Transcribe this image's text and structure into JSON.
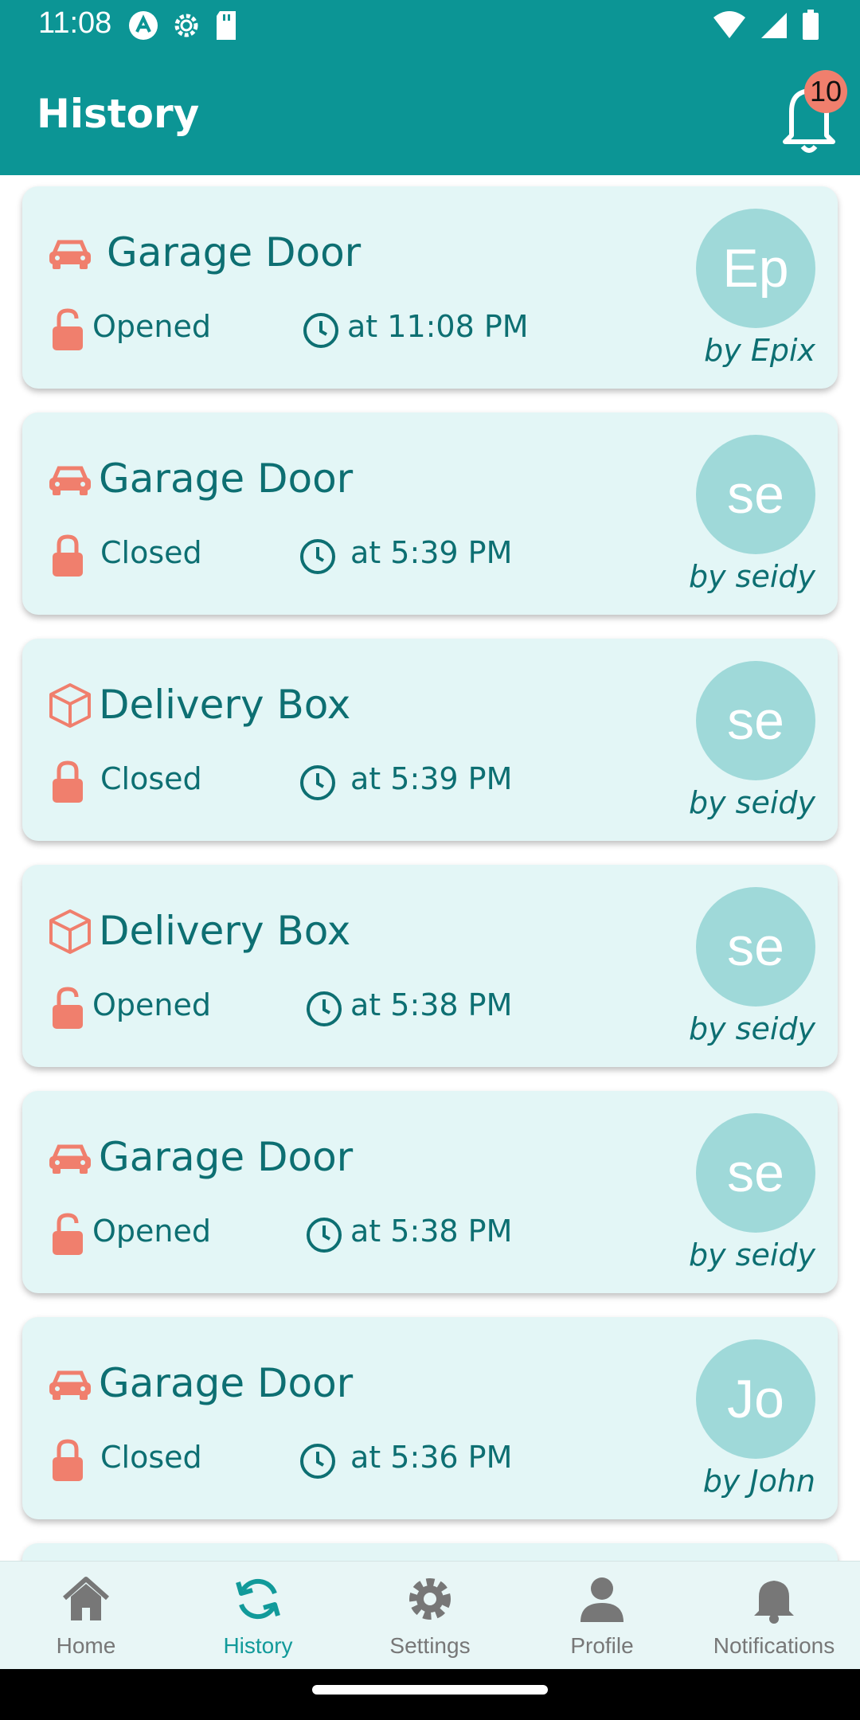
{
  "status_bar": {
    "time": "11:08",
    "left_icons": [
      "app-notification-icon",
      "settings-gear-icon",
      "sd-card-icon"
    ],
    "right_icons": [
      "wifi-icon",
      "cell-signal-icon",
      "battery-icon"
    ]
  },
  "app_bar": {
    "title": "History",
    "notification_count": "10",
    "bell_icon": "bell-icon"
  },
  "history": [
    {
      "device": "Garage Door",
      "device_icon": "car-icon",
      "state": "Opened",
      "lock_state": "unlocked",
      "time": "at 11:08 PM",
      "avatar_initials": "Ep",
      "by": "by Epix"
    },
    {
      "device": "Garage Door",
      "device_icon": "car-icon",
      "state": "Closed",
      "lock_state": "locked",
      "time": "at 5:39 PM",
      "avatar_initials": "se",
      "by": "by seidy"
    },
    {
      "device": "Delivery Box",
      "device_icon": "box-icon",
      "state": "Closed",
      "lock_state": "locked",
      "time": "at 5:39 PM",
      "avatar_initials": "se",
      "by": "by seidy"
    },
    {
      "device": "Delivery Box",
      "device_icon": "box-icon",
      "state": "Opened",
      "lock_state": "unlocked",
      "time": "at 5:38 PM",
      "avatar_initials": "se",
      "by": "by seidy"
    },
    {
      "device": "Garage Door",
      "device_icon": "car-icon",
      "state": "Opened",
      "lock_state": "unlocked",
      "time": "at 5:38 PM",
      "avatar_initials": "se",
      "by": "by seidy"
    },
    {
      "device": "Garage Door",
      "device_icon": "car-icon",
      "state": "Closed",
      "lock_state": "locked",
      "time": "at 5:36 PM",
      "avatar_initials": "Jo",
      "by": "by John"
    }
  ],
  "bottom_nav": {
    "items": [
      {
        "label": "Home",
        "icon": "home-icon"
      },
      {
        "label": "History",
        "icon": "history-icon",
        "active": true
      },
      {
        "label": "Settings",
        "icon": "gear-icon"
      },
      {
        "label": "Profile",
        "icon": "user-icon"
      },
      {
        "label": "Notifications",
        "icon": "bell-icon"
      }
    ]
  },
  "colors": {
    "primary": "#0c9595",
    "card_bg": "#e3f6f6",
    "accent_coral": "#f07f6d",
    "text_teal": "#0d6f72",
    "avatar_bg": "#9fd9d9"
  }
}
